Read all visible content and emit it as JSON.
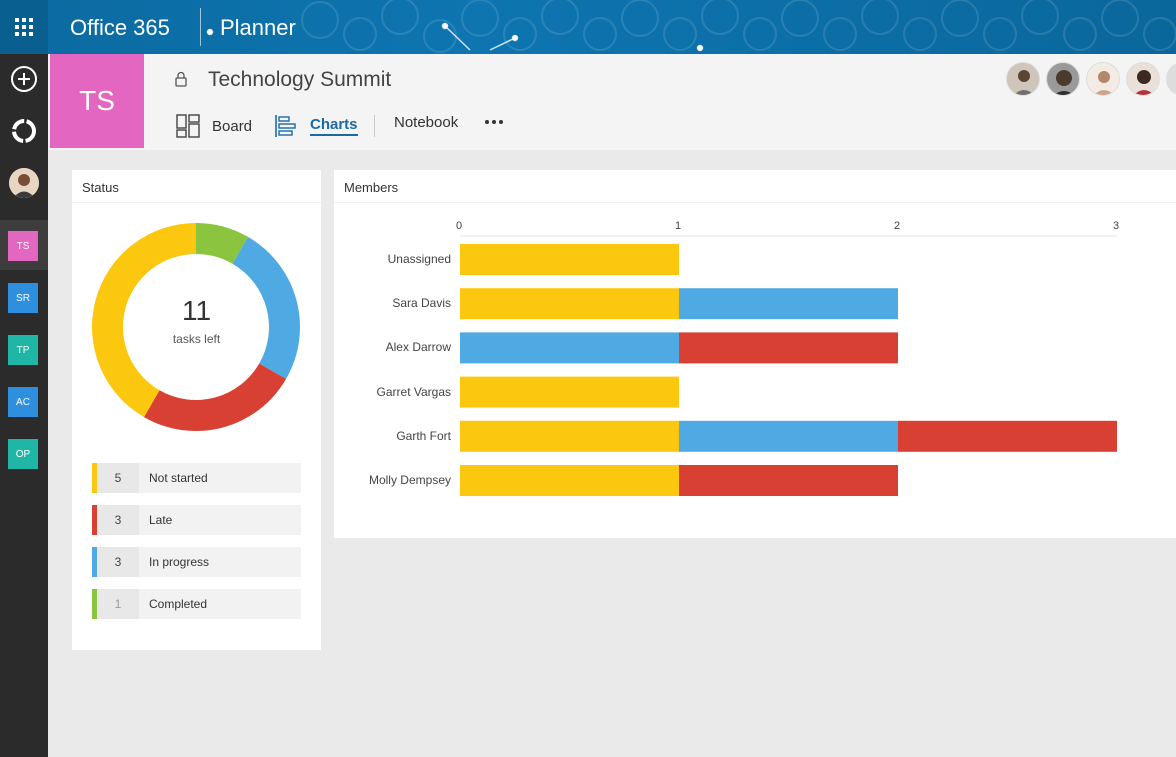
{
  "topbar": {
    "brand": "Office 365",
    "app_name": "Planner"
  },
  "rail": {
    "plans": [
      {
        "abbr": "TS",
        "color": "#e366c1"
      },
      {
        "abbr": "SR",
        "color": "#2f8fdf"
      },
      {
        "abbr": "TP",
        "color": "#1fb6a5"
      },
      {
        "abbr": "AC",
        "color": "#2f8fdf"
      },
      {
        "abbr": "OP",
        "color": "#1fb6a5"
      }
    ]
  },
  "plan": {
    "abbr": "TS",
    "title": "Technology Summit",
    "tabs": {
      "board": "Board",
      "charts": "Charts",
      "notebook": "Notebook"
    }
  },
  "status_card": {
    "title": "Status",
    "tasks_left_count": "11",
    "tasks_left_label": "tasks left",
    "legend": [
      {
        "count": "5",
        "label": "Not started",
        "color": "#fcc70f"
      },
      {
        "count": "3",
        "label": "Late",
        "color": "#d74032"
      },
      {
        "count": "3",
        "label": "In progress",
        "color": "#4fa9e3"
      },
      {
        "count": "1",
        "label": "Completed",
        "color": "#8bc43f"
      }
    ]
  },
  "members_card": {
    "title": "Members"
  },
  "chart_data": [
    {
      "type": "pie",
      "categories": [
        "Not started",
        "Late",
        "In progress",
        "Completed"
      ],
      "values": [
        5,
        3,
        3,
        1
      ],
      "colors": [
        "#fcc70f",
        "#d74032",
        "#4fa9e3",
        "#8bc43f"
      ],
      "style": "donut"
    },
    {
      "type": "bar",
      "orientation": "horizontal",
      "stacked": true,
      "categories": [
        "Unassigned",
        "Sara Davis",
        "Alex Darrow",
        "Garret Vargas",
        "Garth Fort",
        "Molly Dempsey"
      ],
      "series": [
        {
          "name": "Not started",
          "color": "#fcc70f",
          "values": [
            1,
            1,
            0,
            1,
            1,
            1
          ]
        },
        {
          "name": "In progress",
          "color": "#4fa9e3",
          "values": [
            0,
            1,
            1,
            0,
            1,
            0
          ]
        },
        {
          "name": "Late",
          "color": "#d74032",
          "values": [
            0,
            0,
            1,
            0,
            1,
            1
          ]
        }
      ],
      "xticks": [
        "0",
        "1",
        "2",
        "3"
      ],
      "xlim": [
        0,
        3
      ]
    }
  ]
}
